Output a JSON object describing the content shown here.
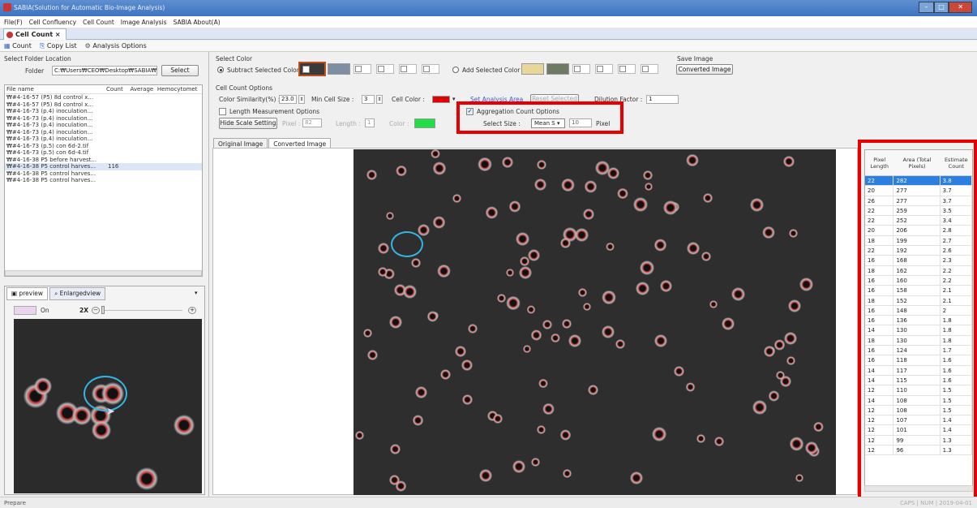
{
  "window": {
    "title": "SABIA(Solution for Automatic Bio-Image Analysis)"
  },
  "menu": [
    "File(F)",
    "Cell Confluency",
    "Cell Count",
    "Image Analysis",
    "SABIA About(A)"
  ],
  "tab": {
    "label": "Cell Count ×"
  },
  "toolbar": {
    "count": "Count",
    "copy_list": "Copy List",
    "analysis_options": "Analysis Options"
  },
  "folder": {
    "section_label": "Select Folder Location",
    "label": "Folder",
    "path": "C:₩Users₩CEO₩Desktop₩SABIA₩A",
    "select_button": "Select"
  },
  "filelist": {
    "headers": [
      "File name",
      "Count",
      "Average",
      "Hemocytomet"
    ],
    "rows": [
      {
        "name": "₩#4-16-57 (P5) 8d control x...",
        "count": ""
      },
      {
        "name": "₩#4-16-57 (P5) 8d control x...",
        "count": ""
      },
      {
        "name": "₩#4-16-73 (p.4) inoculation...",
        "count": ""
      },
      {
        "name": "₩#4-16-73 (p.4) inoculation...",
        "count": ""
      },
      {
        "name": "₩#4-16-73 (p.4) inoculation...",
        "count": ""
      },
      {
        "name": "₩#4-16-73 (p.4) inoculation...",
        "count": ""
      },
      {
        "name": "₩#4-16-73 (p.4) inoculation...",
        "count": ""
      },
      {
        "name": "₩#4-16-73 (p.5) con 6d-2.tif",
        "count": ""
      },
      {
        "name": "₩#4-16-73 (p.5) con 6d-4.tif",
        "count": ""
      },
      {
        "name": "₩#4-16-38 P5 before harvest...",
        "count": ""
      },
      {
        "name": "₩#4-16-38 P5 control harves...",
        "count": "116"
      },
      {
        "name": "₩#4-16-38 P5 control harves...",
        "count": ""
      },
      {
        "name": "₩#4-16-38 P5 control harves...",
        "count": ""
      }
    ]
  },
  "preview": {
    "tab_preview": "preview",
    "tab_enlarged": "Enlargedview",
    "on_label": "On",
    "zoom": "2X"
  },
  "select_color": {
    "section_label": "Select Color",
    "subtract_label": "Subtract Selected Color",
    "add_label": "Add Selected Color",
    "subtract_colors": [
      "#d8d8d8",
      "#7f8fa3"
    ],
    "add_colors": [
      "#e8d79a",
      "#6f7a62"
    ]
  },
  "save_image": {
    "label": "Save Image",
    "button": "Converted Image"
  },
  "cell_count_options": {
    "section_label": "Cell Count Options",
    "similarity_label": "Color Similarity(%) :",
    "similarity_value": "23.0",
    "min_cell_label": "Min Cell Size :",
    "min_cell_value": "3",
    "cell_color_label": "Cell Color :",
    "cell_color": "#e00000",
    "set_area": "Set Analysis Area",
    "reset_selected": "Reset Selected",
    "dilution_label": "Dilution Factor :",
    "dilution_value": "1"
  },
  "length_options": {
    "label": "Length Measurement Options",
    "hide_scale": "Hide Scale Setting",
    "pixel_label": "Pixel :",
    "pixel_value": "82",
    "length_label": "Length :",
    "length_value": "1",
    "color_label": "Color :",
    "color": "#22dd44"
  },
  "aggregation": {
    "label": "Aggregation Count Options",
    "select_size_label": "Select Size :",
    "select_value": "Mean S",
    "size_value": "10",
    "unit": "Pixel"
  },
  "image_tabs": [
    "Original Image",
    "Converted Image"
  ],
  "table": {
    "headers": [
      "Pixel Length",
      "Area (Total Pixels)",
      "Estimate Count"
    ],
    "rows": [
      [
        "22",
        "282",
        "3.8"
      ],
      [
        "20",
        "277",
        "3.7"
      ],
      [
        "26",
        "277",
        "3.7"
      ],
      [
        "22",
        "259",
        "3.5"
      ],
      [
        "22",
        "252",
        "3.4"
      ],
      [
        "20",
        "206",
        "2.8"
      ],
      [
        "18",
        "199",
        "2.7"
      ],
      [
        "22",
        "192",
        "2.6"
      ],
      [
        "16",
        "168",
        "2.3"
      ],
      [
        "18",
        "162",
        "2.2"
      ],
      [
        "16",
        "160",
        "2.2"
      ],
      [
        "16",
        "158",
        "2.1"
      ],
      [
        "18",
        "152",
        "2.1"
      ],
      [
        "16",
        "148",
        "2"
      ],
      [
        "16",
        "136",
        "1.8"
      ],
      [
        "14",
        "130",
        "1.8"
      ],
      [
        "18",
        "130",
        "1.8"
      ],
      [
        "16",
        "124",
        "1.7"
      ],
      [
        "16",
        "118",
        "1.6"
      ],
      [
        "14",
        "117",
        "1.6"
      ],
      [
        "14",
        "115",
        "1.6"
      ],
      [
        "12",
        "110",
        "1.5"
      ],
      [
        "14",
        "108",
        "1.5"
      ],
      [
        "12",
        "108",
        "1.5"
      ],
      [
        "12",
        "107",
        "1.4"
      ],
      [
        "12",
        "101",
        "1.4"
      ],
      [
        "12",
        "99",
        "1.3"
      ],
      [
        "12",
        "96",
        "1.3"
      ]
    ]
  },
  "status": {
    "left": "Prepare",
    "right": "CAPS | NUM | 2019-04-01"
  }
}
